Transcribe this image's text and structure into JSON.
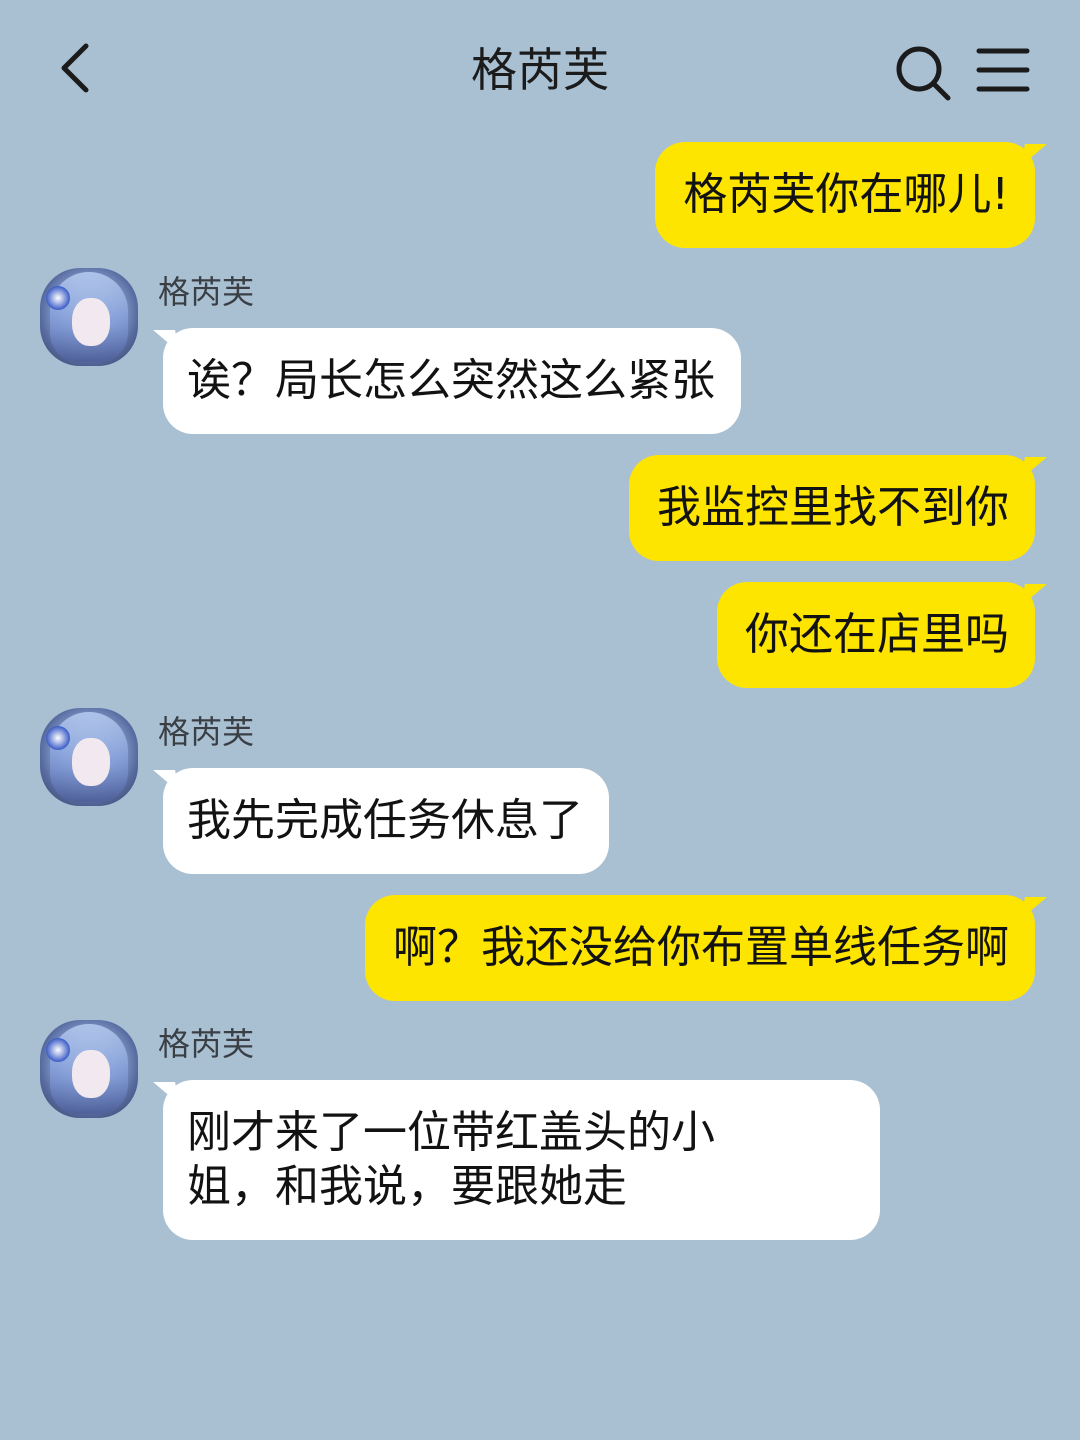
{
  "header": {
    "title": "格芮芙",
    "back_icon": "chevron-left-icon",
    "search_icon": "search-icon",
    "menu_icon": "hamburger-menu-icon"
  },
  "colors": {
    "background": "#a9c0d3",
    "outgoing_bubble": "#fee500",
    "incoming_bubble": "#ffffff"
  },
  "messages": [
    {
      "direction": "out",
      "text": "格芮芙你在哪儿!"
    },
    {
      "direction": "in",
      "sender": "格芮芙",
      "text": "诶？局长怎么突然这么紧张"
    },
    {
      "direction": "out",
      "text": "我监控里找不到你"
    },
    {
      "direction": "out",
      "text": "你还在店里吗"
    },
    {
      "direction": "in",
      "sender": "格芮芙",
      "text": "我先完成任务休息了"
    },
    {
      "direction": "out",
      "text": "啊？我还没给你布置单线任务啊"
    },
    {
      "direction": "in",
      "sender": "格芮芙",
      "text": "刚才来了一位带红盖头的小\n姐，和我说，要跟她走"
    }
  ]
}
